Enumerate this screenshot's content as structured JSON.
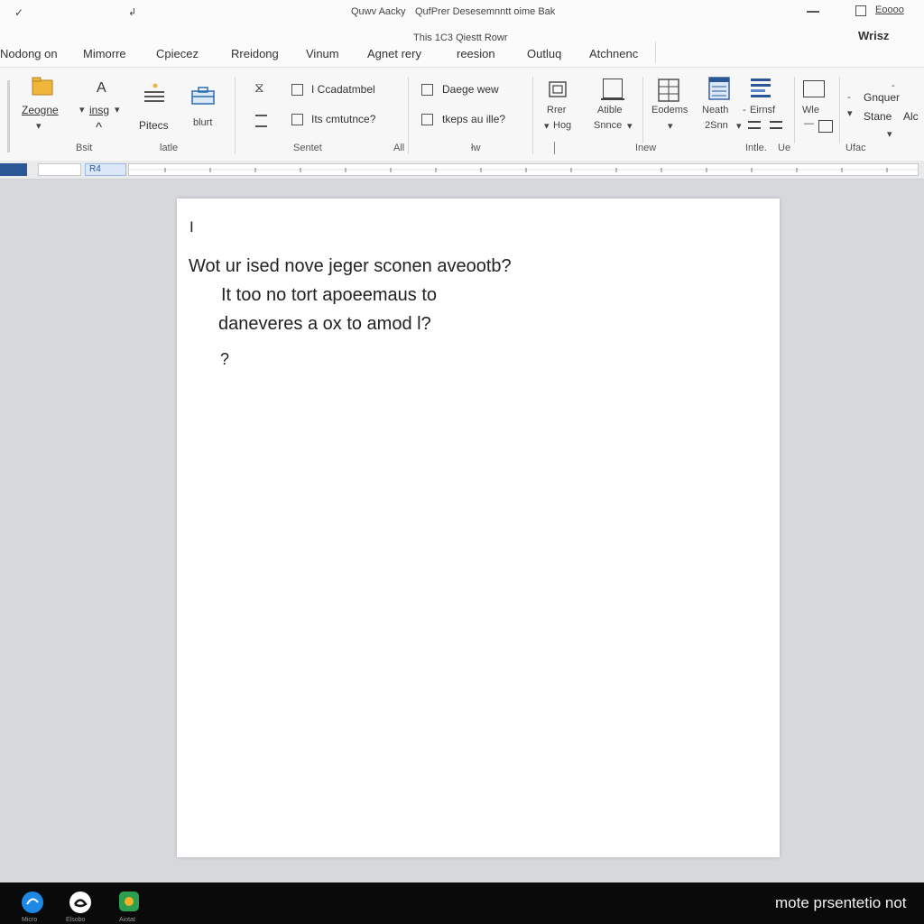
{
  "titlebar": {
    "left_glyph": "✓",
    "left_glyph2": "↲",
    "title_left": "Quwv Aacky",
    "title_right": "QufPrer Desesemnntt oime Bak",
    "right_mark": "Eoooo"
  },
  "menubar": {
    "subtitle": "This 1C3 Qiestt Rowr",
    "items": [
      "Nodong on",
      "Mimorre",
      "Cpiecez",
      "Rreidong",
      "Vinum",
      "Agnet rery",
      "reesion",
      "Outluq",
      "Atchnenc"
    ],
    "right_label": "Wrisz"
  },
  "ribbon": {
    "zeogne_label": "Zeogne",
    "insg_label": "insg",
    "pitecs_label": "Pitecs",
    "blurt_label": "blurt",
    "group_bsit": "Bsit",
    "group_latle": "latle",
    "item_ccadatmbel": "I Ccadatmbel",
    "item_its_cmtnce": "Its cmtutnce?",
    "group_sentet": "Sentet",
    "group_all": "All",
    "item_daege_wew": "Daege wew",
    "item_tkeps": "tkeps au ille?",
    "group_w": "łw",
    "rrer_top": "Rrer",
    "rrer_bottom": "Hog",
    "atible_top": "Atible",
    "atible_bottom": "Snnce",
    "eodems": "Eodems",
    "neath_top": "Neath",
    "neath_bottom": "2Snn",
    "eirnsf": "Eirnsf",
    "wie": "Wle",
    "group_inew": "Inew",
    "group_intle": "Intle.",
    "group_u": "Ue",
    "gnquer": "Gnquer",
    "stane": "Stane",
    "alc": "Alc",
    "group_ufac": "Ufac"
  },
  "ruler": {
    "selected_label": "R4"
  },
  "document": {
    "cursor": "I",
    "line1": "Wot ur ised nove jeger sconen aveootb?",
    "line2": "It too no tort apoeemaus to",
    "line3": "daneveres a ox to amod l?",
    "line4": "?"
  },
  "taskbar": {
    "icons": [
      {
        "name": "edge-icon",
        "label": "Micro",
        "color": "#1e88e5"
      },
      {
        "name": "app-icon",
        "label": "Elsobo",
        "color": "#ffffff"
      },
      {
        "name": "photos-icon",
        "label": "Aiotat",
        "color": "#2e9e4f"
      }
    ],
    "right_text": "mote prsentetio not"
  },
  "colors": {
    "accent": "#2b5797",
    "ribbon_bg": "#f7f7f7",
    "canvas_bg": "#d6d8db",
    "taskbar_bg": "#0a0a0a"
  }
}
